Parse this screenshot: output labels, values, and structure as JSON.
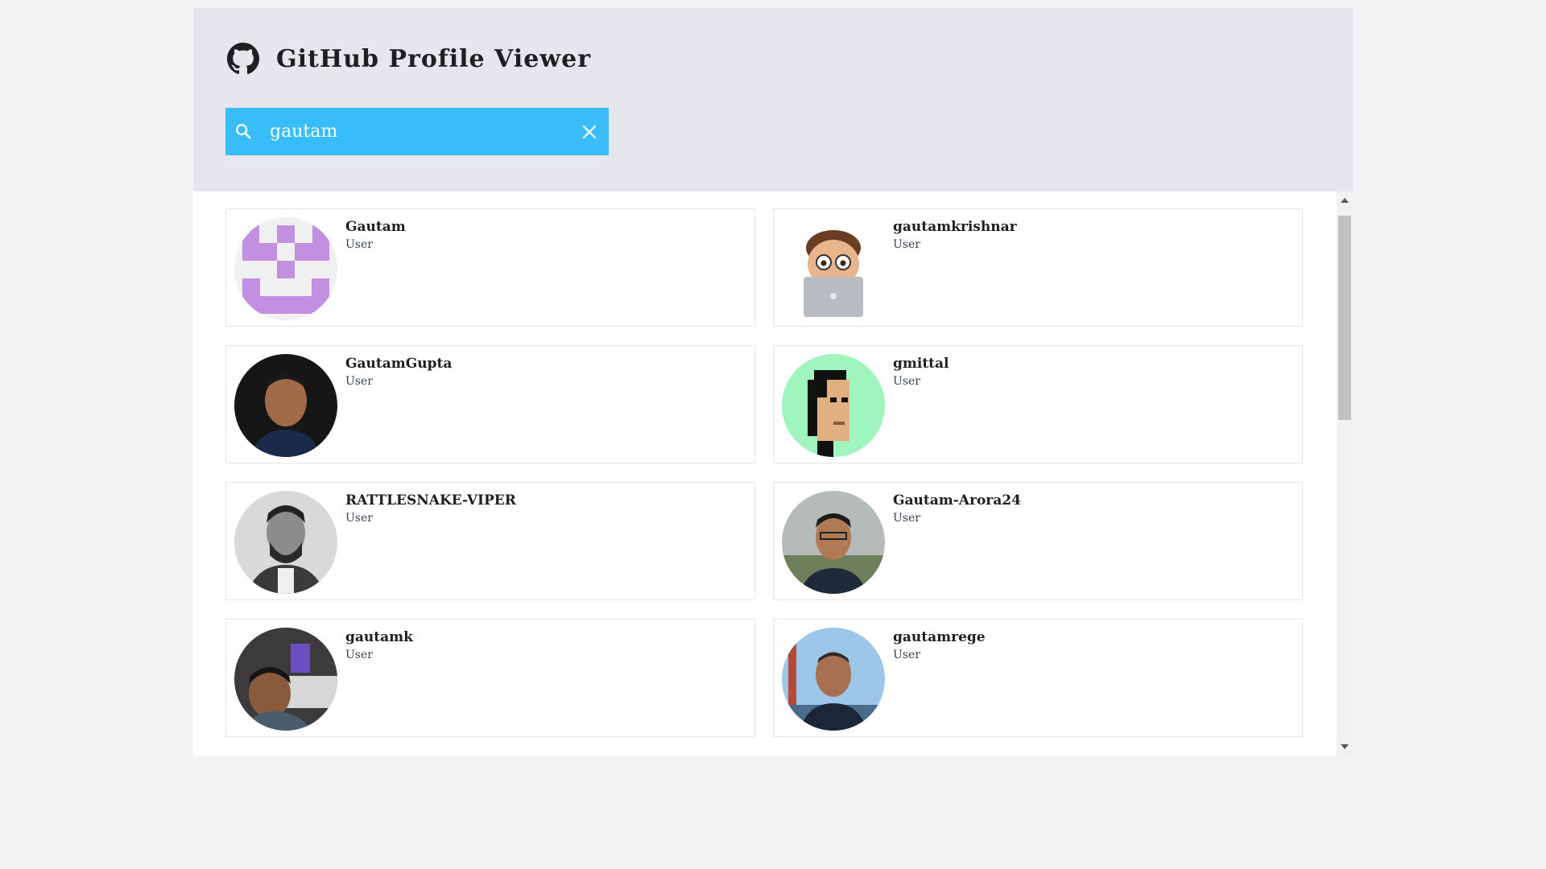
{
  "app": {
    "title": "GitHub Profile Viewer",
    "logo_icon": "github-octocat-icon"
  },
  "search": {
    "icon": "search-icon",
    "value": "gautam",
    "clear_icon": "close-icon"
  },
  "results": [
    {
      "login": "Gautam",
      "type": "User",
      "avatar": "identicon-purple"
    },
    {
      "login": "gautamkrishnar",
      "type": "User",
      "avatar": "memoji-laptop"
    },
    {
      "login": "GautamGupta",
      "type": "User",
      "avatar": "photo"
    },
    {
      "login": "gmittal",
      "type": "User",
      "avatar": "pixel-art-green"
    },
    {
      "login": "RATTLESNAKE-VIPER",
      "type": "User",
      "avatar": "photo-bw"
    },
    {
      "login": "Gautam-Arora24",
      "type": "User",
      "avatar": "photo"
    },
    {
      "login": "gautamk",
      "type": "User",
      "avatar": "photo"
    },
    {
      "login": "gautamrege",
      "type": "User",
      "avatar": "photo"
    }
  ],
  "colors": {
    "header_bg": "#e5e7eb",
    "search_bg": "#38bdf8",
    "page_bg": "#f4f4f5",
    "identicon": "#c38fe0"
  }
}
